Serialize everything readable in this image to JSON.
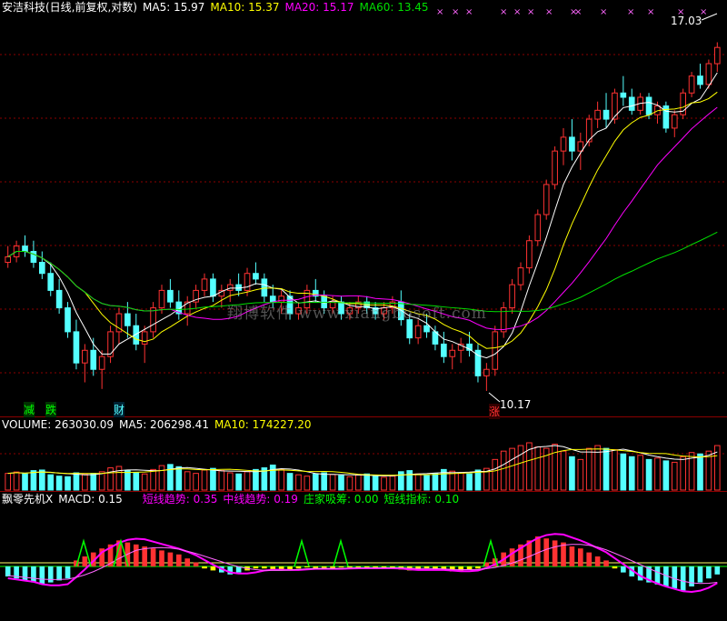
{
  "price_header": {
    "title": "安洁科技(日线,前复权,对数)",
    "ma5": "MA5: 15.97",
    "ma10": "MA10: 15.37",
    "ma20": "MA20: 15.17",
    "ma60": "MA60: 13.45"
  },
  "price_annotations": {
    "high_label": "17.03",
    "low_label": "10.17",
    "tag_jian": "减",
    "tag_die": "跌",
    "tag_cai": "财",
    "tag_zhang": "涨"
  },
  "watermark": "翔博软件 www.xiangbosoft.com",
  "volume_header": {
    "volume": "VOLUME: 263030.09",
    "ma5": "MA5: 206298.41",
    "ma10": "MA10: 174227.20"
  },
  "indicator_header": {
    "name": "飘零先机X",
    "macd": "MACD: 0.15",
    "short_trend": "短线趋势: 0.35",
    "mid_trend": "中线趋势: 0.19",
    "accumulation": "庄家吸筹: 0.00",
    "short_index": "短线指标: 0.10"
  },
  "colors": {
    "up": "#ff3232",
    "down": "#54ffff",
    "ma5": "#ffffff",
    "ma10": "#ffff00",
    "ma20": "#ff00ff",
    "ma60": "#00e000",
    "grid": "#8b0000",
    "label_green": "#00ff00"
  },
  "chart_data": {
    "type": "candlestick",
    "title": "安洁科技(日线,前复权,对数)",
    "ylim": [
      9.9,
      17.6
    ],
    "low_marker": 10.17,
    "high_marker": 17.03,
    "ohlc": [
      [
        12.3,
        12.6,
        12.2,
        12.4
      ],
      [
        12.4,
        12.7,
        12.3,
        12.6
      ],
      [
        12.6,
        12.8,
        12.4,
        12.5
      ],
      [
        12.5,
        12.7,
        12.2,
        12.3
      ],
      [
        12.3,
        12.5,
        12.0,
        12.1
      ],
      [
        12.1,
        12.3,
        11.7,
        11.8
      ],
      [
        11.8,
        12.0,
        11.4,
        11.5
      ],
      [
        11.5,
        11.6,
        11.0,
        11.1
      ],
      [
        11.1,
        11.3,
        10.5,
        10.6
      ],
      [
        10.6,
        10.9,
        10.3,
        10.8
      ],
      [
        10.8,
        11.0,
        10.4,
        10.5
      ],
      [
        10.5,
        10.8,
        10.2,
        10.7
      ],
      [
        10.7,
        11.2,
        10.6,
        11.1
      ],
      [
        11.1,
        11.5,
        10.9,
        11.4
      ],
      [
        11.4,
        11.6,
        11.0,
        11.2
      ],
      [
        11.2,
        11.4,
        10.8,
        10.9
      ],
      [
        10.9,
        11.2,
        10.6,
        11.1
      ],
      [
        11.1,
        11.6,
        11.0,
        11.5
      ],
      [
        11.5,
        11.9,
        11.4,
        11.8
      ],
      [
        11.8,
        12.0,
        11.5,
        11.6
      ],
      [
        11.6,
        11.8,
        11.3,
        11.4
      ],
      [
        11.4,
        11.7,
        11.2,
        11.6
      ],
      [
        11.6,
        11.9,
        11.5,
        11.8
      ],
      [
        11.8,
        12.1,
        11.7,
        12.0
      ],
      [
        12.0,
        12.1,
        11.6,
        11.7
      ],
      [
        11.7,
        11.9,
        11.5,
        11.8
      ],
      [
        11.8,
        12.0,
        11.6,
        11.9
      ],
      [
        11.9,
        12.1,
        11.7,
        11.8
      ],
      [
        11.8,
        12.2,
        11.7,
        12.1
      ],
      [
        12.1,
        12.3,
        11.9,
        12.0
      ],
      [
        12.0,
        12.1,
        11.6,
        11.7
      ],
      [
        11.7,
        11.9,
        11.5,
        11.6
      ],
      [
        11.6,
        11.8,
        11.4,
        11.7
      ],
      [
        11.7,
        11.8,
        11.3,
        11.4
      ],
      [
        11.4,
        11.6,
        11.3,
        11.5
      ],
      [
        11.5,
        11.9,
        11.4,
        11.8
      ],
      [
        11.8,
        12.0,
        11.6,
        11.7
      ],
      [
        11.7,
        11.8,
        11.4,
        11.5
      ],
      [
        11.5,
        11.7,
        11.4,
        11.6
      ],
      [
        11.6,
        11.7,
        11.3,
        11.4
      ],
      [
        11.4,
        11.6,
        11.3,
        11.5
      ],
      [
        11.5,
        11.7,
        11.4,
        11.6
      ],
      [
        11.6,
        11.7,
        11.4,
        11.5
      ],
      [
        11.5,
        11.6,
        11.3,
        11.4
      ],
      [
        11.4,
        11.6,
        11.3,
        11.5
      ],
      [
        11.5,
        11.7,
        11.4,
        11.6
      ],
      [
        11.6,
        11.8,
        11.2,
        11.3
      ],
      [
        11.3,
        11.4,
        10.9,
        11.0
      ],
      [
        11.0,
        11.3,
        10.9,
        11.2
      ],
      [
        11.2,
        11.4,
        11.0,
        11.1
      ],
      [
        11.1,
        11.2,
        10.8,
        10.9
      ],
      [
        10.9,
        11.1,
        10.6,
        10.7
      ],
      [
        10.7,
        10.9,
        10.5,
        10.8
      ],
      [
        10.8,
        11.0,
        10.6,
        10.9
      ],
      [
        10.9,
        11.1,
        10.7,
        10.8
      ],
      [
        10.8,
        10.9,
        10.3,
        10.4
      ],
      [
        10.4,
        10.6,
        10.17,
        10.5
      ],
      [
        10.5,
        11.2,
        10.4,
        11.1
      ],
      [
        11.1,
        11.6,
        11.0,
        11.5
      ],
      [
        11.5,
        12.0,
        11.4,
        11.9
      ],
      [
        11.9,
        12.3,
        11.8,
        12.2
      ],
      [
        12.2,
        12.8,
        12.1,
        12.7
      ],
      [
        12.7,
        13.3,
        12.6,
        13.2
      ],
      [
        13.2,
        13.9,
        13.1,
        13.8
      ],
      [
        13.8,
        14.6,
        13.7,
        14.5
      ],
      [
        14.5,
        15.0,
        14.2,
        14.8
      ],
      [
        14.8,
        15.2,
        14.3,
        14.5
      ],
      [
        14.5,
        14.9,
        14.1,
        14.7
      ],
      [
        14.7,
        15.3,
        14.6,
        15.2
      ],
      [
        15.2,
        15.6,
        15.0,
        15.4
      ],
      [
        15.4,
        15.8,
        15.0,
        15.2
      ],
      [
        15.2,
        15.9,
        15.1,
        15.8
      ],
      [
        15.8,
        16.2,
        15.5,
        15.7
      ],
      [
        15.7,
        15.9,
        15.3,
        15.4
      ],
      [
        15.4,
        15.8,
        15.3,
        15.7
      ],
      [
        15.7,
        15.8,
        15.2,
        15.3
      ],
      [
        15.3,
        15.6,
        15.1,
        15.5
      ],
      [
        15.5,
        15.6,
        14.9,
        15.0
      ],
      [
        15.0,
        15.4,
        14.8,
        15.3
      ],
      [
        15.3,
        15.9,
        15.2,
        15.8
      ],
      [
        15.8,
        16.3,
        15.7,
        16.2
      ],
      [
        16.2,
        16.5,
        15.9,
        16.0
      ],
      [
        16.0,
        16.6,
        15.9,
        16.5
      ],
      [
        16.5,
        17.03,
        16.3,
        16.9
      ]
    ],
    "volume": [
      60,
      65,
      58,
      70,
      72,
      55,
      50,
      48,
      62,
      58,
      60,
      66,
      80,
      85,
      70,
      62,
      58,
      74,
      88,
      92,
      84,
      66,
      60,
      72,
      78,
      70,
      62,
      58,
      66,
      74,
      80,
      90,
      75,
      60,
      55,
      50,
      58,
      62,
      56,
      52,
      48,
      54,
      58,
      50,
      46,
      50,
      66,
      70,
      58,
      52,
      60,
      74,
      68,
      62,
      58,
      72,
      78,
      110,
      140,
      150,
      160,
      170,
      155,
      150,
      165,
      140,
      120,
      110,
      150,
      160,
      150,
      145,
      130,
      120,
      125,
      110,
      115,
      105,
      100,
      120,
      135,
      130,
      140,
      160
    ],
    "histogram": [
      -10,
      -12,
      -14,
      -16,
      -18,
      -16,
      -14,
      -12,
      6,
      10,
      14,
      18,
      22,
      26,
      24,
      22,
      20,
      18,
      16,
      14,
      12,
      8,
      4,
      -2,
      -4,
      -6,
      -8,
      -6,
      -4,
      -2,
      -2,
      -3,
      -4,
      -3,
      -2,
      -1,
      -2,
      -3,
      -2,
      -1,
      -1,
      -2,
      -2,
      -1,
      -1,
      -2,
      -3,
      -4,
      -3,
      -2,
      -3,
      -4,
      -5,
      -4,
      -3,
      -2,
      4,
      8,
      14,
      18,
      22,
      26,
      30,
      28,
      26,
      24,
      20,
      18,
      14,
      10,
      6,
      -2,
      -6,
      -10,
      -14,
      -16,
      -18,
      -20,
      -22,
      -24,
      -20,
      -16,
      -12,
      -8
    ]
  }
}
